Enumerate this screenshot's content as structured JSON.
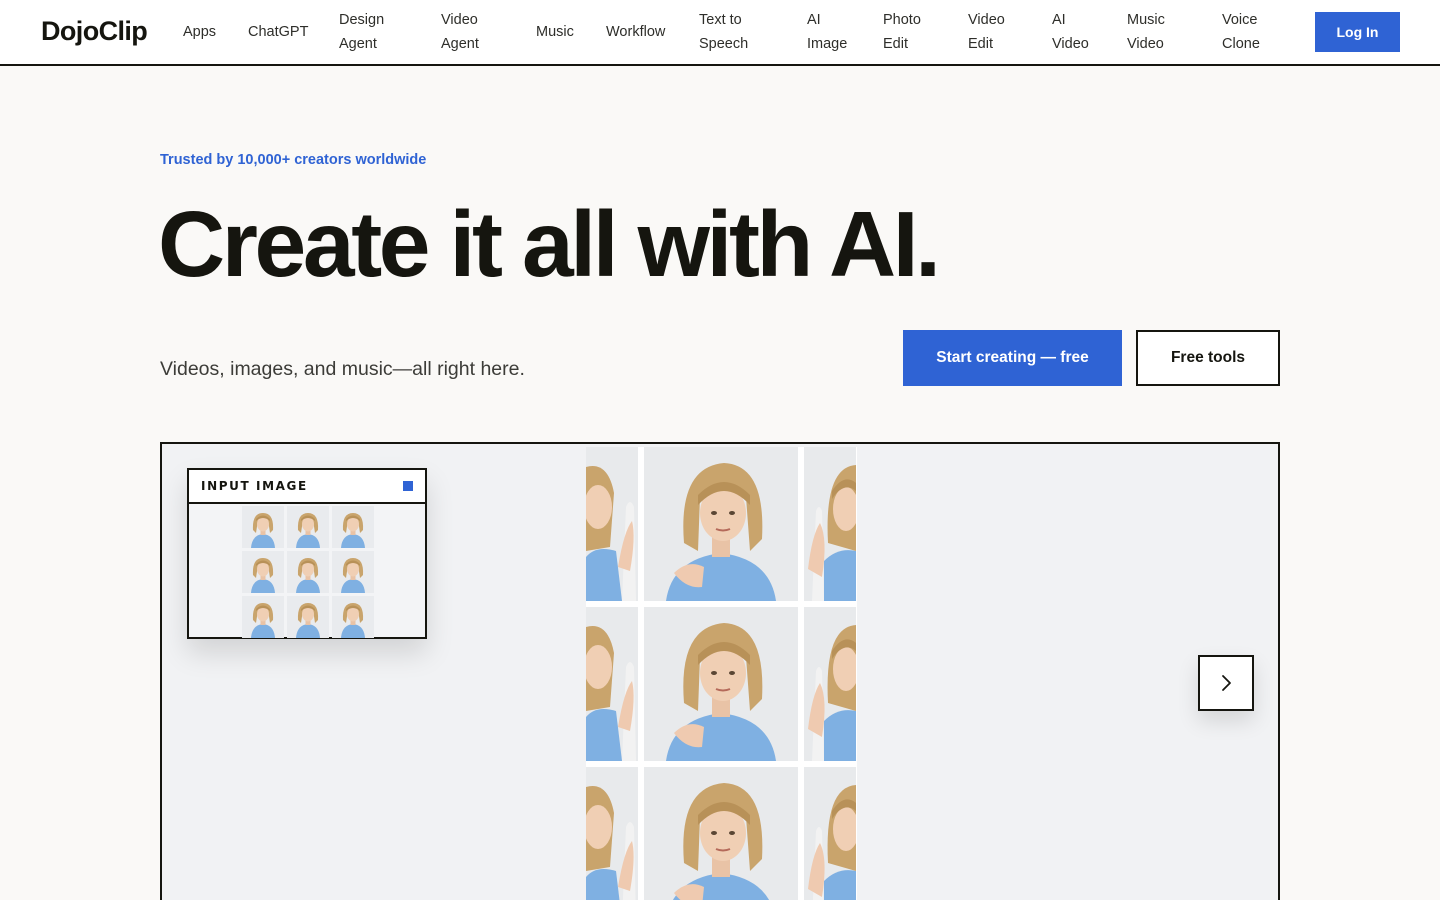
{
  "brand": {
    "logo": "DojoClip"
  },
  "nav": {
    "items": [
      {
        "key": "apps",
        "label": "Apps"
      },
      {
        "key": "chatgpt",
        "label": "ChatGPT"
      },
      {
        "key": "design-agent",
        "label": "Design\nAgent"
      },
      {
        "key": "video-agent",
        "label": "Video\nAgent"
      },
      {
        "key": "music",
        "label": "Music"
      },
      {
        "key": "workflow",
        "label": "Workflow"
      },
      {
        "key": "text-to-speech",
        "label": "Text to\nSpeech"
      },
      {
        "key": "ai-image",
        "label": "AI\nImage"
      },
      {
        "key": "photo-edit",
        "label": "Photo\nEdit"
      },
      {
        "key": "video-edit",
        "label": "Video\nEdit"
      },
      {
        "key": "ai-video",
        "label": "AI\nVideo"
      },
      {
        "key": "music-video",
        "label": "Music\nVideo"
      },
      {
        "key": "voice-clone",
        "label": "Voice\nClone"
      }
    ],
    "login_label": "Log In"
  },
  "hero": {
    "trusted_text": "Trusted by 10,000+ creators worldwide",
    "headline": "Create it all with AI.",
    "subhead": "Videos, images, and music—all right here.",
    "cta_primary": "Start creating — free",
    "cta_secondary": "Free tools"
  },
  "showcase": {
    "input_card_title": "INPUT IMAGE",
    "next_icon": "chevron-right-icon",
    "grid_thumbnails": 9
  },
  "colors": {
    "accent": "#2f63d4",
    "ink": "#15150f",
    "page_bg": "#faf9f7",
    "showcase_bg": "#f1f2f4",
    "shirt_blue": "#7fb0e2",
    "hair_blonde": "#c9a46c"
  }
}
